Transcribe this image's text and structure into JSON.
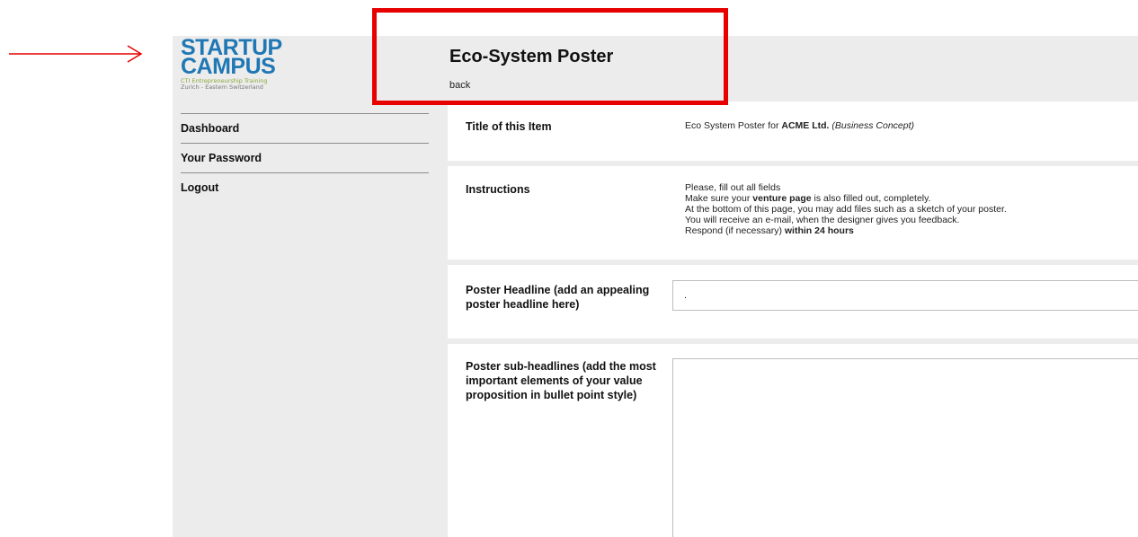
{
  "logo": {
    "line1": "STARTUP",
    "line2": "CAMPUS",
    "tagline1": "CTI Entrepreneurship Training",
    "tagline2": "Zurich - Eastern Switzerland",
    "brand_color": "#1f77b4",
    "tagline_color": "#8aa83a"
  },
  "sidebar": {
    "items": [
      {
        "label": "Dashboard"
      },
      {
        "label": "Your Password"
      },
      {
        "label": "Logout"
      }
    ]
  },
  "header": {
    "title": "Eco-System Poster",
    "back_label": "back"
  },
  "annotation": {
    "color": "#e60000"
  },
  "form": {
    "title_item": {
      "label": "Title of this Item",
      "value_prefix": "Eco System Poster for ",
      "value_company": "ACME Ltd.",
      "value_suffix": "(Business Concept)"
    },
    "instructions": {
      "label": "Instructions",
      "line1": "Please, fill out all fields",
      "line2_pre": "Make sure your ",
      "line2_bold": "venture page",
      "line2_post": " is also filled out, completely.",
      "line3": "At the bottom of this page, you may add files such as a sketch of your poster.",
      "line4": "You will receive an e-mail, when the designer gives you feedback.",
      "line5_pre": "Respond (if necessary) ",
      "line5_bold": "within 24 hours"
    },
    "headline": {
      "label": "Poster Headline (add an appealing poster headline here)",
      "value": "."
    },
    "subheadlines": {
      "label": "Poster sub-headlines (add the most important elements of your value proposition in bullet point style)",
      "value": ""
    }
  }
}
